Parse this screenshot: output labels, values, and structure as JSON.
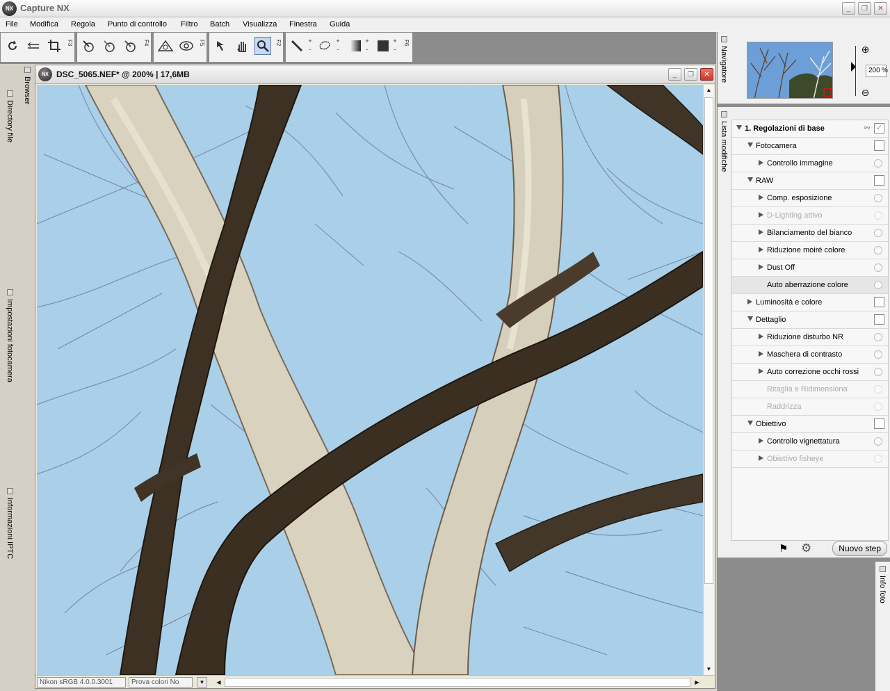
{
  "app": {
    "title": "Capture NX",
    "logo_text": "NX"
  },
  "window_buttons": {
    "minimize": "_",
    "maximize": "❐",
    "close": "✕"
  },
  "menu": [
    "File",
    "Modifica",
    "Regola",
    "Punto di controllo",
    "Filtro",
    "Batch",
    "Visualizza",
    "Finestra",
    "Guida"
  ],
  "toolbar": {
    "fkeys": [
      "F3",
      "F4",
      "F5",
      "F2",
      "F6"
    ]
  },
  "left_dock": {
    "tabs": [
      "Directory file",
      "Impostazioni fotocamera",
      "Informazioni IPTC"
    ],
    "browser_tab": "Browser"
  },
  "document": {
    "title": "DSC_5065.NEF* @ 200% | 17,6MB",
    "status_profile": "Nikon sRGB 4.0.0.3001",
    "status_proof": "Prova colori No"
  },
  "navigator": {
    "tab_label": "Navigatore",
    "zoom_value": "200",
    "zoom_unit": "%"
  },
  "edit_list": {
    "tab_label": "Lista modifiche",
    "rows": [
      {
        "label": "1. Regolazioni di base",
        "level": 0,
        "expand": "down",
        "control": "header",
        "bold": true
      },
      {
        "label": "Fotocamera",
        "level": 1,
        "expand": "down",
        "control": "check"
      },
      {
        "label": "Controllo immagine",
        "level": 2,
        "expand": "right",
        "control": "radio"
      },
      {
        "label": "RAW",
        "level": 1,
        "expand": "down",
        "control": "check"
      },
      {
        "label": "Comp. esposizione",
        "level": 2,
        "expand": "right",
        "control": "radio"
      },
      {
        "label": "D-Lighting attivo",
        "level": 2,
        "expand": "right",
        "control": "radio",
        "dim": true
      },
      {
        "label": "Bilanciamento del bianco",
        "level": 2,
        "expand": "right",
        "control": "radio"
      },
      {
        "label": "Riduzione moiré colore",
        "level": 2,
        "expand": "right",
        "control": "radio"
      },
      {
        "label": "Dust Off",
        "level": 2,
        "expand": "right",
        "control": "radio"
      },
      {
        "label": "Auto aberrazione colore",
        "level": 2,
        "expand": "none",
        "control": "radio",
        "highlight": true
      },
      {
        "label": "Luminosità e colore",
        "level": 1,
        "expand": "right",
        "control": "check"
      },
      {
        "label": "Dettaglio",
        "level": 1,
        "expand": "down",
        "control": "check"
      },
      {
        "label": "Riduzione disturbo NR",
        "level": 2,
        "expand": "right",
        "control": "radio"
      },
      {
        "label": "Maschera di contrasto",
        "level": 2,
        "expand": "right",
        "control": "radio"
      },
      {
        "label": "Auto correzione occhi rossi",
        "level": 2,
        "expand": "right",
        "control": "radio"
      },
      {
        "label": "Ritaglia e Ridimensiona",
        "level": 2,
        "expand": "none",
        "control": "radio",
        "dim": true
      },
      {
        "label": "Raddrizza",
        "level": 2,
        "expand": "none",
        "control": "radio",
        "dim": true
      },
      {
        "label": "Obiettivo",
        "level": 1,
        "expand": "down",
        "control": "check"
      },
      {
        "label": "Controllo vignettatura",
        "level": 2,
        "expand": "right",
        "control": "radio"
      },
      {
        "label": "Obiettivo fisheye",
        "level": 2,
        "expand": "right",
        "control": "radio",
        "dim": true
      }
    ],
    "new_step_label": "Nuovo step"
  },
  "info_panel": {
    "tab_label": "Info foto"
  },
  "colors": {
    "sky": "#a9d0e8",
    "panel_bg": "#f0f0f0",
    "dock_gray": "#8c8c8c",
    "close_red": "#d9453a"
  },
  "icons": [
    "rotate-icon",
    "straighten-icon",
    "crop-icon",
    "black-point-icon",
    "white-point-icon",
    "neutral-point-icon",
    "red-eye-icon",
    "eye-icon",
    "arrow-icon",
    "hand-icon",
    "zoom-icon",
    "brush-icon",
    "lasso-icon",
    "gradient-icon",
    "fill-icon"
  ]
}
